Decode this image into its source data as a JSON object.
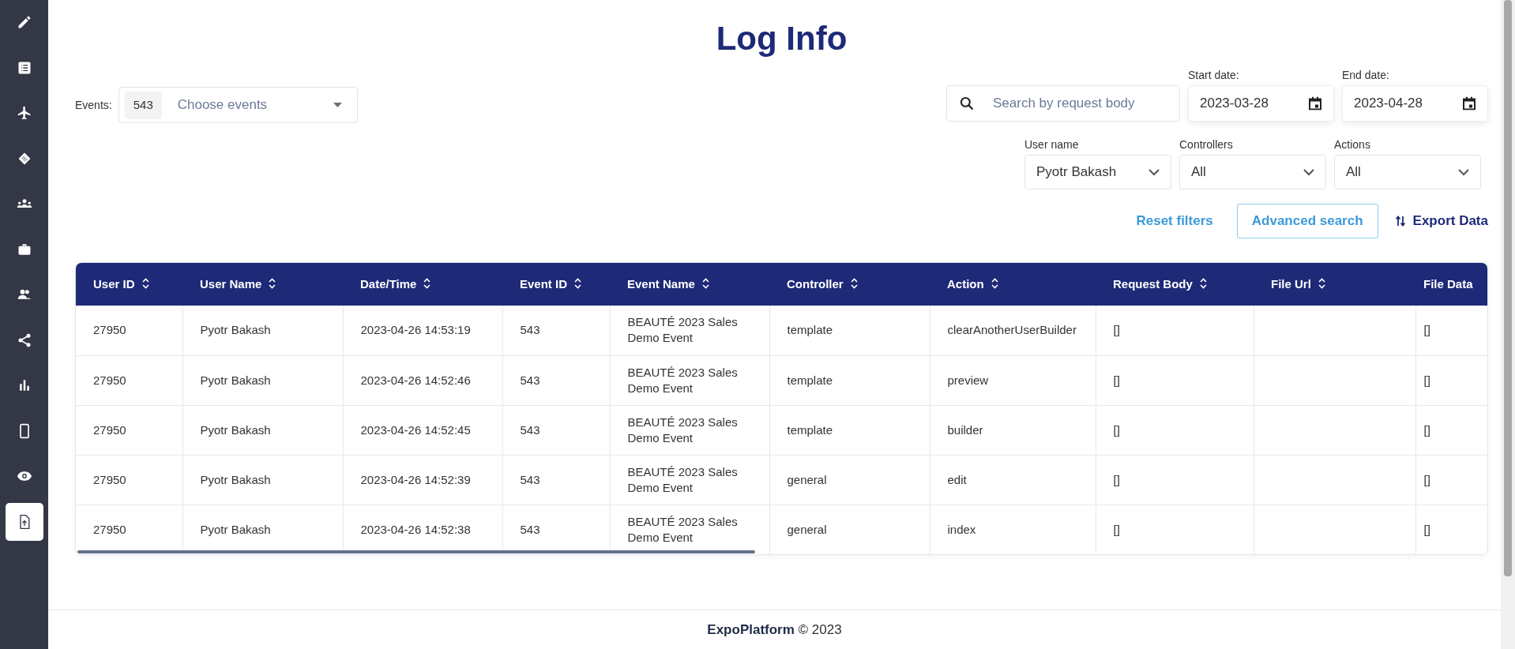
{
  "sidebar": {
    "items": [
      {
        "selected": false
      },
      {
        "selected": false
      },
      {
        "selected": false
      },
      {
        "selected": false
      },
      {
        "selected": false
      },
      {
        "selected": false
      },
      {
        "selected": false
      },
      {
        "selected": false
      },
      {
        "selected": false
      },
      {
        "selected": false
      },
      {
        "selected": false
      },
      {
        "selected": true
      }
    ]
  },
  "title": "Log Info",
  "filters": {
    "events": {
      "label": "Events:",
      "chip": "543",
      "placeholder": "Choose events"
    },
    "search": {
      "placeholder": "Search by request body"
    },
    "start_date": {
      "label": "Start date:",
      "value": "2023-03-28"
    },
    "end_date": {
      "label": "End date:",
      "value": "2023-04-28"
    },
    "user_name": {
      "label": "User name",
      "value": "Pyotr Bakash"
    },
    "controllers": {
      "label": "Controllers",
      "value": "All"
    },
    "actions": {
      "label": "Actions",
      "value": "All"
    }
  },
  "buttons": {
    "reset": "Reset filters",
    "advanced": "Advanced search",
    "export": "Export Data"
  },
  "table": {
    "columns": [
      "User ID",
      "User Name",
      "Date/Time",
      "Event ID",
      "Event Name",
      "Controller",
      "Action",
      "Request Body",
      "File Url",
      "File Data"
    ],
    "rows": [
      [
        "27950",
        "Pyotr Bakash",
        "2023-04-26 14:53:19",
        "543",
        "BEAUTÉ 2023 Sales Demo Event",
        "template",
        "clearAnotherUserBuilder",
        "[]",
        "",
        "[]"
      ],
      [
        "27950",
        "Pyotr Bakash",
        "2023-04-26 14:52:46",
        "543",
        "BEAUTÉ 2023 Sales Demo Event",
        "template",
        "preview",
        "[]",
        "",
        "[]"
      ],
      [
        "27950",
        "Pyotr Bakash",
        "2023-04-26 14:52:45",
        "543",
        "BEAUTÉ 2023 Sales Demo Event",
        "template",
        "builder",
        "[]",
        "",
        "[]"
      ],
      [
        "27950",
        "Pyotr Bakash",
        "2023-04-26 14:52:39",
        "543",
        "BEAUTÉ 2023 Sales Demo Event",
        "general",
        "edit",
        "[]",
        "",
        "[]"
      ],
      [
        "27950",
        "Pyotr Bakash",
        "2023-04-26 14:52:38",
        "543",
        "BEAUTÉ 2023 Sales Demo Event",
        "general",
        "index",
        "[]",
        "",
        "[]"
      ]
    ]
  },
  "footer": {
    "text": "**ExpoPlatform** © 2023"
  }
}
